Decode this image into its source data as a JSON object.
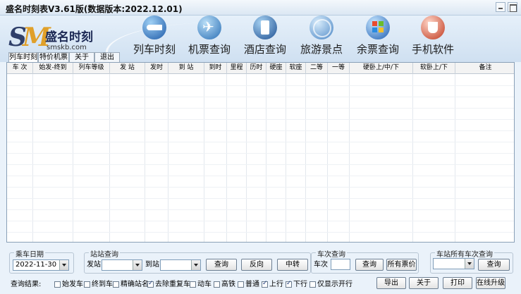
{
  "window": {
    "title": "盛名时刻表V3.61版(数据版本:2022.12.01)"
  },
  "logo": {
    "mark": "SM",
    "name": "盛名时刻",
    "domain": "smskb.com"
  },
  "nav": [
    {
      "label": "列车时刻",
      "icon": "train-icon"
    },
    {
      "label": "机票查询",
      "icon": "airplane-icon"
    },
    {
      "label": "酒店查询",
      "icon": "hotel-icon"
    },
    {
      "label": "旅游景点",
      "icon": "globe-icon"
    },
    {
      "label": "余票查询",
      "icon": "windows-icon"
    },
    {
      "label": "手机软件",
      "icon": "java-icon"
    }
  ],
  "tabs": [
    "列车时刻",
    "特价机票",
    "关于",
    "退出"
  ],
  "table": {
    "headers": [
      "车 次",
      "始发-终到",
      "列车等级",
      "发 站",
      "发时",
      "到 站",
      "到时",
      "里程",
      "历时",
      "硬座",
      "软座",
      "二等",
      "一等",
      "硬卧上/中/下",
      "软卧上/下",
      "备注"
    ]
  },
  "ride_date": {
    "label": "乘车日期",
    "value": "2022-11-30"
  },
  "station_query": {
    "label": "站站查询",
    "from_label": "发站",
    "to_label": "到站",
    "query_btn": "查询",
    "reverse_btn": "反向",
    "transfer_btn": "中转"
  },
  "train_query": {
    "label": "车次查询",
    "train_label": "车次",
    "query_btn": "查询",
    "fares_btn": "所有票价"
  },
  "station_all": {
    "label": "车站所有车次查询",
    "query_btn": "查询"
  },
  "result": {
    "label": "查询结果:",
    "filters": [
      {
        "label": "始发车",
        "checked": false
      },
      {
        "label": "终到车",
        "checked": false
      },
      {
        "label": "精确站名",
        "checked": false
      },
      {
        "label": "去除重复车",
        "checked": true
      },
      {
        "label": "动车",
        "checked": false
      },
      {
        "label": "高铁",
        "checked": false
      },
      {
        "label": "普通",
        "checked": false
      },
      {
        "label": "上行",
        "checked": true
      },
      {
        "label": "下行",
        "checked": true
      },
      {
        "label": "仅显示开行",
        "checked": false
      }
    ]
  },
  "actions": {
    "export": "导出",
    "about": "关于",
    "print": "打印",
    "upgrade": "在线升级"
  }
}
